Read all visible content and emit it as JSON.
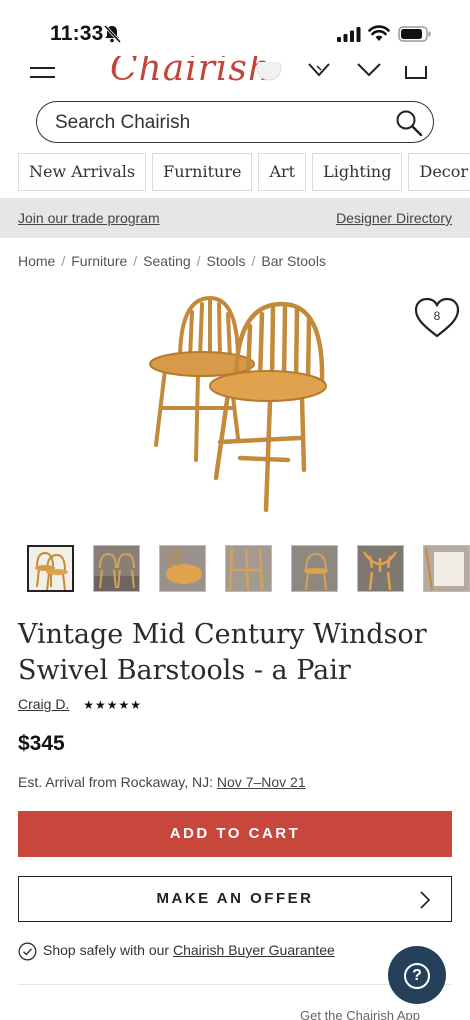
{
  "status_bar": {
    "time": "11:33"
  },
  "header": {
    "logo_text": "Chairish"
  },
  "search": {
    "placeholder": "Search Chairish"
  },
  "categories": [
    "New Arrivals",
    "Furniture",
    "Art",
    "Lighting",
    "Decor"
  ],
  "trade_bar": {
    "left_link": "Join our trade program",
    "right_link": "Designer Directory"
  },
  "breadcrumb": [
    "Home",
    "Furniture",
    "Seating",
    "Stools",
    "Bar Stools"
  ],
  "favorite": {
    "count": "8"
  },
  "thumbnails_count": 7,
  "product": {
    "title": "Vintage Mid Century Windsor Swivel Barstools - a Pair",
    "seller": "Craig D.",
    "rating_stars": "★★★★★",
    "price": "$345",
    "arrival_prefix": "Est. Arrival from Rockaway, NJ:",
    "arrival_dates": "Nov 7–Nov 21"
  },
  "actions": {
    "add_to_cart": "ADD TO CART",
    "make_offer": "MAKE AN OFFER"
  },
  "guarantee": {
    "prefix": "Shop safely with our",
    "link": "Chairish Buyer Guarantee"
  },
  "help": {
    "icon_label": "?"
  },
  "app_promo": "Get the Chairish App",
  "colors": {
    "brand": "#c7473c",
    "help_button": "#25405a",
    "trade_bar": "#e6e6e6"
  }
}
